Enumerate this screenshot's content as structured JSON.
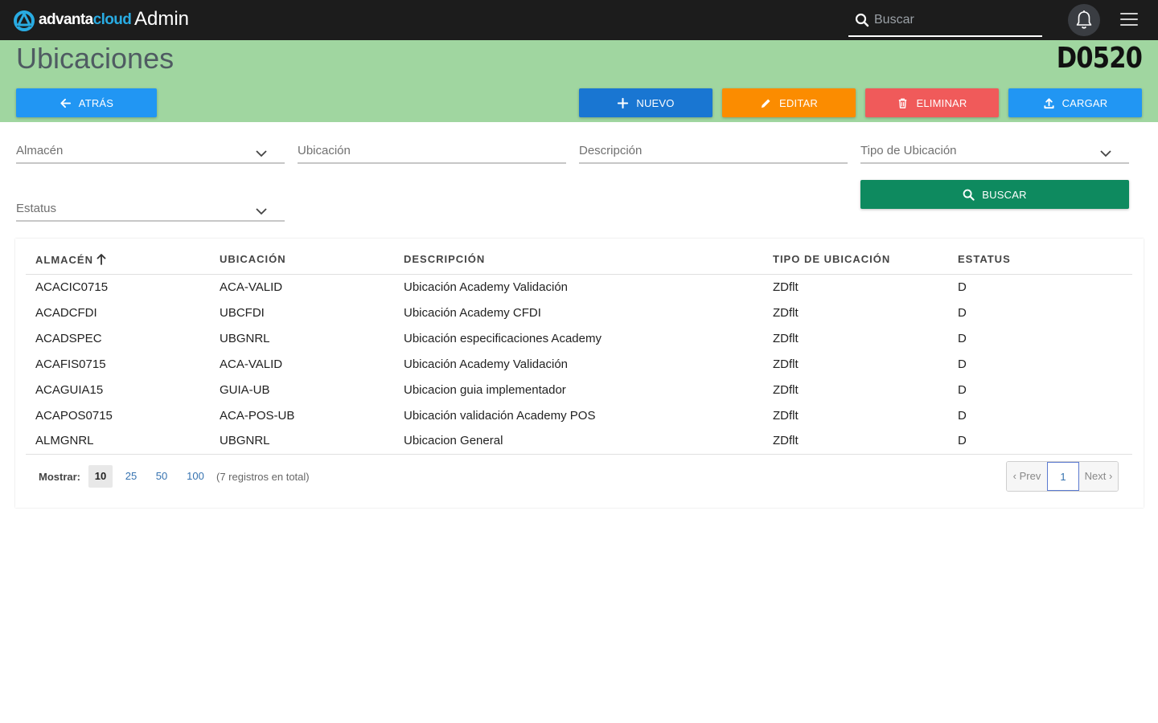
{
  "app": {
    "logo_part1": "advanta",
    "logo_part2": "cloud",
    "title": "Admin",
    "search_placeholder": "Buscar"
  },
  "header": {
    "title": "Ubicaciones",
    "code": "D0520"
  },
  "toolbar": {
    "back_label": "ATRÁS",
    "new_label": "NUEVO",
    "edit_label": "EDITAR",
    "delete_label": "ELIMINAR",
    "upload_label": "CARGAR"
  },
  "filters": {
    "warehouse": "Almacén",
    "location": "Ubicación",
    "description": "Descripción",
    "location_type": "Tipo de Ubicación",
    "status": "Estatus",
    "search_label": "BUSCAR"
  },
  "table": {
    "columns": [
      "ALMACÉN",
      "UBICACIÓN",
      "DESCRIPCIÓN",
      "TIPO DE UBICACIÓN",
      "ESTATUS"
    ],
    "rows": [
      [
        "ACACIC0715",
        "ACA-VALID",
        "Ubicación Academy Validación",
        "ZDflt",
        "D"
      ],
      [
        "ACADCFDI",
        "UBCFDI",
        "Ubicación Academy CFDI",
        "ZDflt",
        "D"
      ],
      [
        "ACADSPEC",
        "UBGNRL",
        "Ubicación especificaciones Academy",
        "ZDflt",
        "D"
      ],
      [
        "ACAFIS0715",
        "ACA-VALID",
        "Ubicación Academy Validación",
        "ZDflt",
        "D"
      ],
      [
        "ACAGUIA15",
        "GUIA-UB",
        "Ubicacion guia implementador",
        "ZDflt",
        "D"
      ],
      [
        "ACAPOS0715",
        "ACA-POS-UB",
        "Ubicación validación Academy POS",
        "ZDflt",
        "D"
      ],
      [
        "ALMGNRL",
        "UBGNRL",
        "Ubicacion General",
        "ZDflt",
        "D"
      ]
    ]
  },
  "pagination": {
    "show_label": "Mostrar:",
    "sizes": [
      "10",
      "25",
      "50",
      "100"
    ],
    "total_text": "(7 registros en total)",
    "prev": "‹ Prev",
    "current": "1",
    "next": "Next ›"
  },
  "colors": {
    "topbar": "#1c1c1c",
    "band": "#a0d6a0",
    "back": "#2196f3",
    "new": "#1976d2",
    "edit": "#fb8c00",
    "delete": "#f05a5a",
    "upload": "#2196f3",
    "search": "#0e8a5f"
  }
}
